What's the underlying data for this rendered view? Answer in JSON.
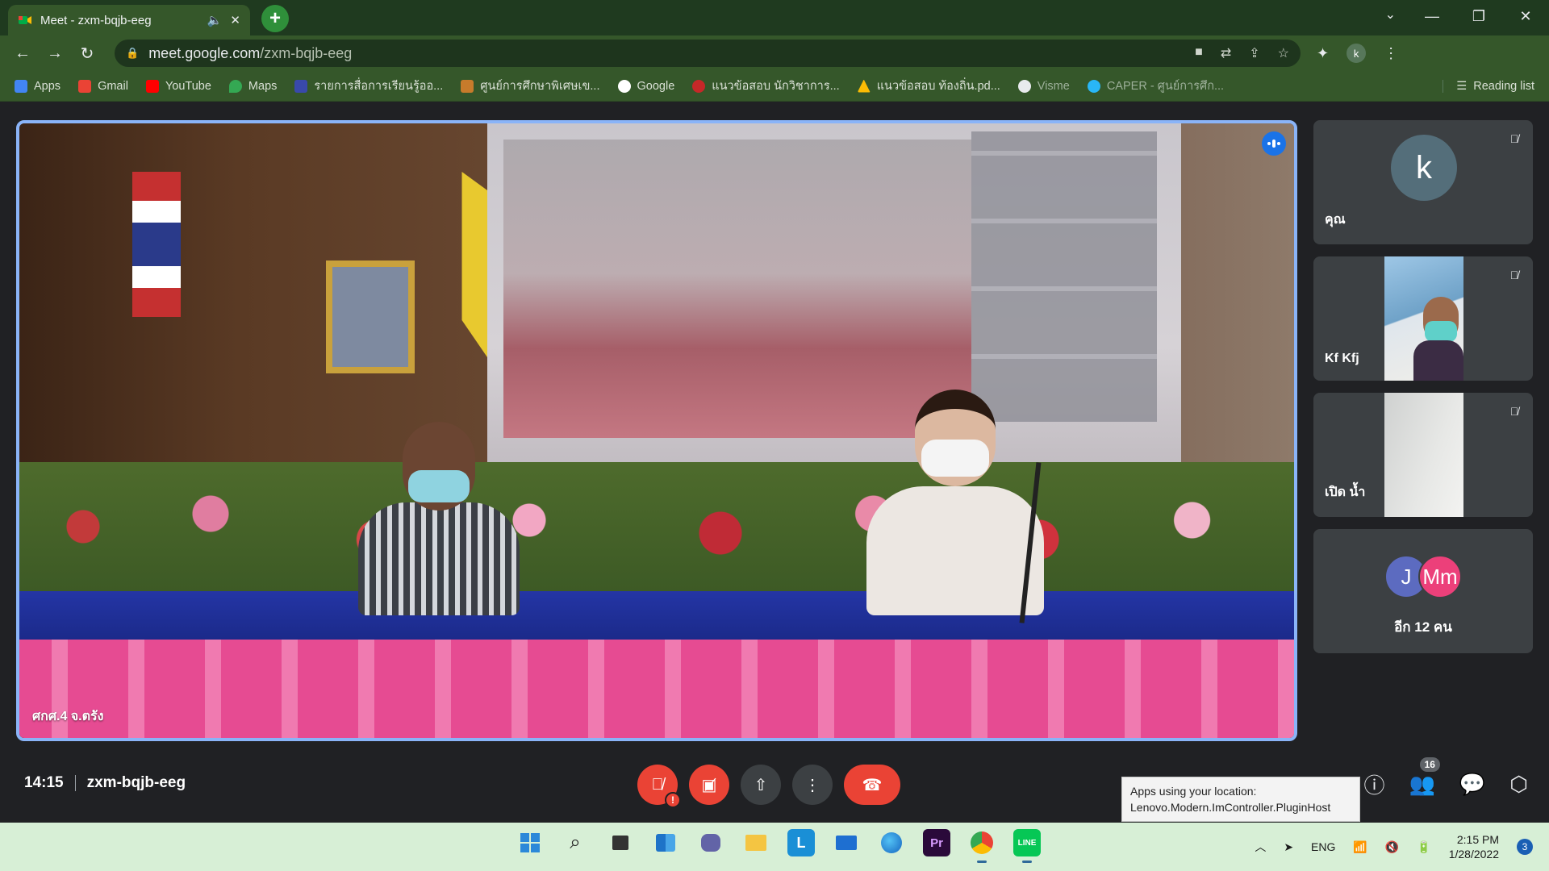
{
  "browser": {
    "tab": {
      "title": "Meet - zxm-bqjb-eeg",
      "sound_icon": "speaker-icon",
      "close_icon": "close-icon"
    },
    "new_tab_icon": "plus-icon",
    "url_host": "meet.google.com",
    "url_path": "/zxm-bqjb-eeg",
    "profile_initial": "k",
    "bookmarks": [
      {
        "label": "Apps",
        "icon": "apps-grid-icon",
        "color": "#4285f4"
      },
      {
        "label": "Gmail",
        "icon": "gmail-icon",
        "color": "#ea4335"
      },
      {
        "label": "YouTube",
        "icon": "youtube-icon",
        "color": "#ff0000"
      },
      {
        "label": "Maps",
        "icon": "maps-icon",
        "color": "#34a853"
      },
      {
        "label": "รายการสื่อการเรียนรู้ออ...",
        "icon": "calendar-icon",
        "color": "#3949ab"
      },
      {
        "label": "ศูนย์การศึกษาพิเศษเข...",
        "icon": "site-icon",
        "color": "#c77b2b"
      },
      {
        "label": "Google",
        "icon": "google-icon",
        "color": "#ffffff"
      },
      {
        "label": "แนวข้อสอบ นักวิชาการ...",
        "icon": "site-icon",
        "color": "#c62828"
      },
      {
        "label": "แนวข้อสอบ ท้องถิ่น.pd...",
        "icon": "drive-icon",
        "color": "#fbbc04"
      },
      {
        "label": "Visme",
        "icon": "visme-icon",
        "color": "#e8eaed"
      },
      {
        "label": "CAPER - ศูนย์การศึก...",
        "icon": "caper-icon",
        "color": "#29b6f6"
      }
    ],
    "reading_list": "Reading list"
  },
  "meet": {
    "main_speaker": "ศกศ.4 จ.ตรัง",
    "participants": [
      {
        "name": "คุณ",
        "initial": "k"
      },
      {
        "name": "Kf Kfj"
      },
      {
        "name": "เปิด น้ำ"
      }
    ],
    "more": {
      "initials": [
        "J",
        "Mm"
      ],
      "label": "อีก 12 คน"
    },
    "time": "14:15",
    "meeting_code": "zxm-bqjb-eeg",
    "participant_count": "16",
    "tooltip_line1": "Apps using your location:",
    "tooltip_line2": "Lenovo.Modern.ImController.PluginHost"
  },
  "taskbar": {
    "language": "ENG",
    "time": "2:15 PM",
    "date": "1/28/2022",
    "notifications": "3"
  },
  "colors": {
    "accent": "#8ab4f8",
    "end_call": "#ea4335",
    "chrome_theme": "#35572a"
  }
}
